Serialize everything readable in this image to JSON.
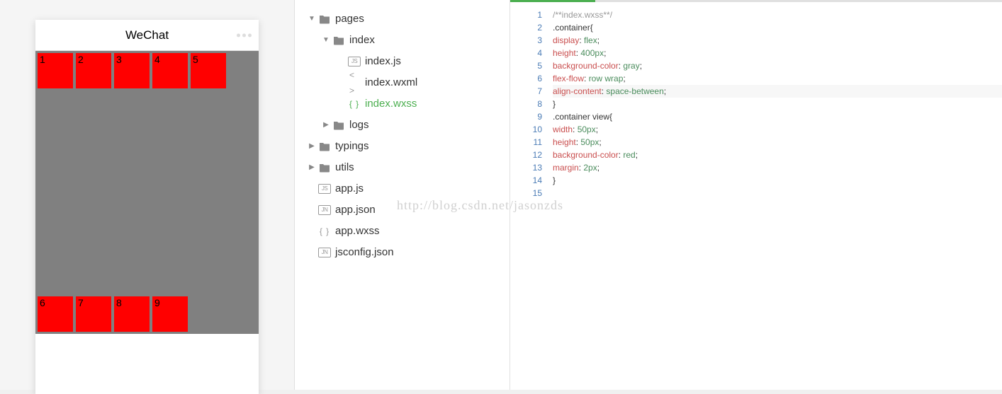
{
  "simulator": {
    "title": "WeChat",
    "items": [
      "1",
      "2",
      "3",
      "4",
      "5",
      "6",
      "7",
      "8",
      "9"
    ]
  },
  "tree": {
    "items": [
      {
        "level": 0,
        "arrow": "down",
        "icon": "folder",
        "label": "pages"
      },
      {
        "level": 1,
        "arrow": "down",
        "icon": "folder",
        "label": "index"
      },
      {
        "level": 2,
        "arrow": "",
        "icon": "js",
        "label": "index.js"
      },
      {
        "level": 2,
        "arrow": "",
        "icon": "diamond",
        "label": "index.wxml"
      },
      {
        "level": 2,
        "arrow": "",
        "icon": "brace",
        "label": "index.wxss",
        "active": true
      },
      {
        "level": 1,
        "arrow": "right",
        "icon": "folder",
        "label": "logs"
      },
      {
        "level": 0,
        "arrow": "right",
        "icon": "folder",
        "label": "typings"
      },
      {
        "level": 0,
        "arrow": "right",
        "icon": "folder",
        "label": "utils"
      },
      {
        "level": 0,
        "arrow": "",
        "icon": "js",
        "label": "app.js"
      },
      {
        "level": 0,
        "arrow": "",
        "icon": "jn",
        "label": "app.json"
      },
      {
        "level": 0,
        "arrow": "",
        "icon": "brace",
        "label": "app.wxss"
      },
      {
        "level": 0,
        "arrow": "",
        "icon": "jn",
        "label": "jsconfig.json"
      }
    ]
  },
  "editor": {
    "lineCount": 15,
    "highlightLine": 7,
    "lines": [
      {
        "tokens": [
          {
            "t": "/**index.wxss**/",
            "c": "comment"
          }
        ]
      },
      {
        "tokens": [
          {
            "t": ".container",
            "c": "sel"
          },
          {
            "t": "{",
            "c": "punc"
          }
        ]
      },
      {
        "tokens": [
          {
            "t": "display",
            "c": "prop"
          },
          {
            "t": ": ",
            "c": "punc"
          },
          {
            "t": "flex",
            "c": "val"
          },
          {
            "t": ";",
            "c": "punc"
          }
        ]
      },
      {
        "tokens": [
          {
            "t": "height",
            "c": "prop"
          },
          {
            "t": ": ",
            "c": "punc"
          },
          {
            "t": "400px",
            "c": "val"
          },
          {
            "t": ";",
            "c": "punc"
          }
        ]
      },
      {
        "tokens": [
          {
            "t": "background-color",
            "c": "prop"
          },
          {
            "t": ": ",
            "c": "punc"
          },
          {
            "t": "gray",
            "c": "val"
          },
          {
            "t": ";",
            "c": "punc"
          }
        ]
      },
      {
        "tokens": [
          {
            "t": "flex-flow",
            "c": "prop"
          },
          {
            "t": ": ",
            "c": "punc"
          },
          {
            "t": "row wrap",
            "c": "val"
          },
          {
            "t": ";",
            "c": "punc"
          }
        ]
      },
      {
        "tokens": [
          {
            "t": "align-content",
            "c": "prop"
          },
          {
            "t": ": ",
            "c": "punc"
          },
          {
            "t": "space-between",
            "c": "val"
          },
          {
            "t": ";",
            "c": "punc"
          }
        ]
      },
      {
        "tokens": [
          {
            "t": "}",
            "c": "punc"
          }
        ]
      },
      {
        "tokens": [
          {
            "t": ".container view",
            "c": "sel"
          },
          {
            "t": "{",
            "c": "punc"
          }
        ]
      },
      {
        "tokens": [
          {
            "t": "width",
            "c": "prop"
          },
          {
            "t": ": ",
            "c": "punc"
          },
          {
            "t": "50px",
            "c": "val"
          },
          {
            "t": ";",
            "c": "punc"
          }
        ]
      },
      {
        "tokens": [
          {
            "t": "height",
            "c": "prop"
          },
          {
            "t": ": ",
            "c": "punc"
          },
          {
            "t": "50px",
            "c": "val"
          },
          {
            "t": ";",
            "c": "punc"
          }
        ]
      },
      {
        "tokens": [
          {
            "t": "background-color",
            "c": "prop"
          },
          {
            "t": ": ",
            "c": "punc"
          },
          {
            "t": "red",
            "c": "val"
          },
          {
            "t": ";",
            "c": "punc"
          }
        ]
      },
      {
        "tokens": [
          {
            "t": "margin",
            "c": "prop"
          },
          {
            "t": ": ",
            "c": "punc"
          },
          {
            "t": "2px",
            "c": "val"
          },
          {
            "t": ";",
            "c": "punc"
          }
        ]
      },
      {
        "tokens": [
          {
            "t": "}",
            "c": "punc"
          }
        ]
      },
      {
        "tokens": []
      }
    ]
  },
  "watermark": "http://blog.csdn.net/jasonzds"
}
